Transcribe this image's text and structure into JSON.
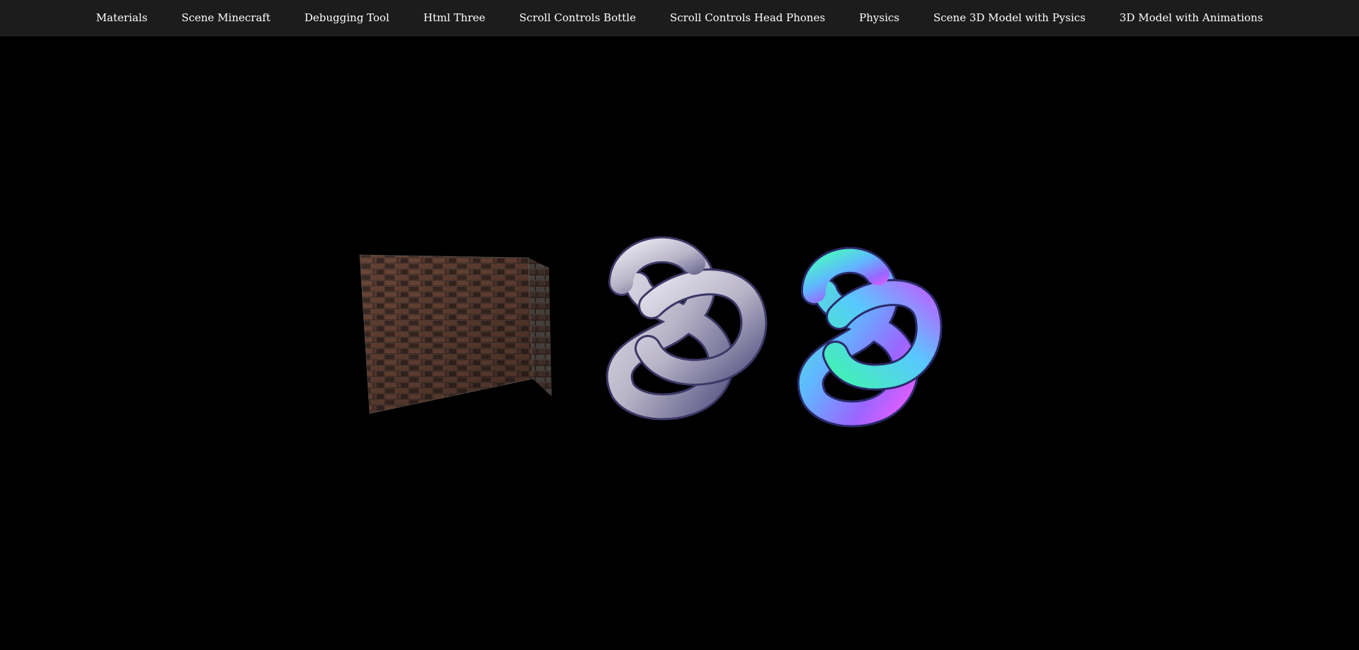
{
  "nav": {
    "items": [
      {
        "label": "Materials"
      },
      {
        "label": "Scene Minecraft"
      },
      {
        "label": "Debugging Tool"
      },
      {
        "label": "Html Three"
      },
      {
        "label": "Scroll Controls Bottle"
      },
      {
        "label": "Scroll Controls Head Phones"
      },
      {
        "label": "Physics"
      },
      {
        "label": "Scene 3D Model with Pysics"
      },
      {
        "label": "3D Model with Animations"
      }
    ]
  },
  "scene": {
    "background": "#000000",
    "objects": [
      {
        "name": "brick-cube",
        "material": "brick texture",
        "color": "#5a3a2c"
      },
      {
        "name": "torus-knot-standard",
        "material": "standard",
        "color": "#b9b6c9"
      },
      {
        "name": "torus-knot-normal",
        "material": "normal",
        "color": "#7a6cf0"
      }
    ]
  }
}
